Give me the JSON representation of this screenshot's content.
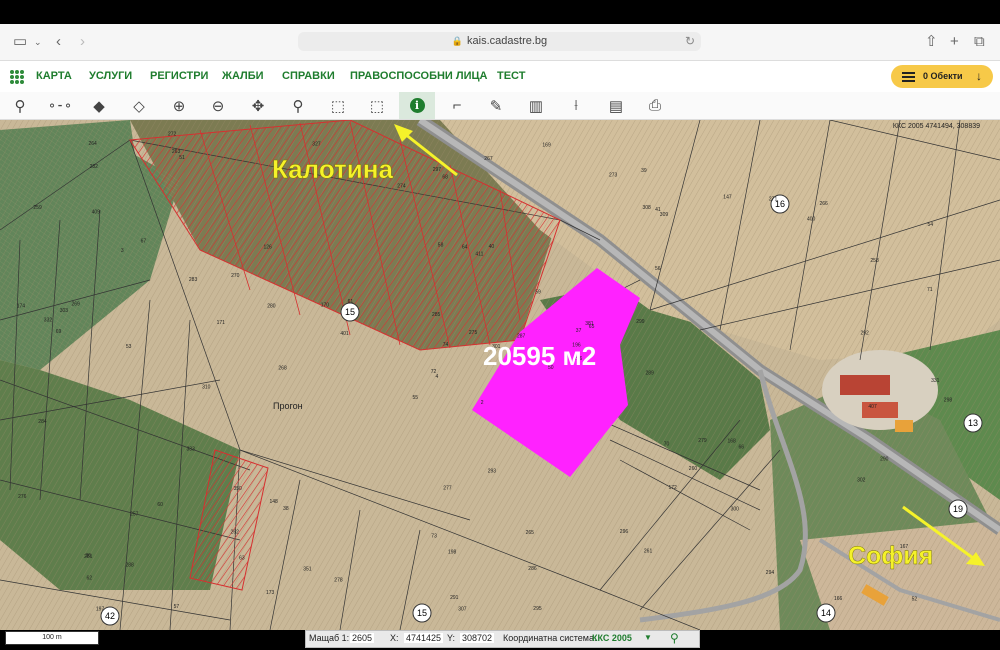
{
  "browser": {
    "url": "kais.cadastre.bg"
  },
  "menu": {
    "items": [
      "КАРТА",
      "УСЛУГИ",
      "РЕГИСТРИ",
      "ЖАЛБИ",
      "СПРАВКИ",
      "ПРАВОСПОСОБНИ ЛИЦА",
      "ТЕСТ"
    ],
    "objects_label": "0 Обекти"
  },
  "toolbar": {
    "tools": [
      "search-icon",
      "graph-icon",
      "layers-icon",
      "layers-stack-icon",
      "zoom-in-icon",
      "zoom-out-icon",
      "pan-icon",
      "location-pin-icon",
      "select-add-icon",
      "select-remove-icon",
      "info-icon",
      "corner-measure-icon",
      "draw-polygon-icon",
      "map-icon",
      "split-icon",
      "edit-document-icon",
      "print-icon"
    ],
    "active_tool": "info-icon"
  },
  "map": {
    "coord_readout": "ККС 2005 4741494, 308839",
    "labels": {
      "kalotina": "Калотина",
      "sofia": "София",
      "area": "20595 м2",
      "progon": "Прогон"
    },
    "road_numbers": [
      "15",
      "16",
      "13",
      "19",
      "14",
      "15",
      "42"
    ],
    "parcel_numbers": [
      "2",
      "3",
      "4",
      "36",
      "37",
      "38",
      "39",
      "40",
      "41",
      "50",
      "51",
      "52",
      "53",
      "54",
      "55",
      "56",
      "57",
      "58",
      "59",
      "60",
      "61",
      "62",
      "63",
      "64",
      "65",
      "66",
      "67",
      "68",
      "69",
      "70",
      "71",
      "72",
      "73",
      "74",
      "126",
      "147",
      "148",
      "166",
      "167",
      "168",
      "169",
      "170",
      "171",
      "172",
      "173",
      "174",
      "196",
      "197",
      "198",
      "256",
      "257",
      "258",
      "259",
      "260",
      "261",
      "262",
      "263",
      "264",
      "265",
      "266",
      "267",
      "268",
      "269",
      "270",
      "271",
      "272",
      "273",
      "274",
      "275",
      "276",
      "277",
      "278",
      "279",
      "280",
      "281",
      "282",
      "283",
      "284",
      "285",
      "286",
      "287",
      "288",
      "289",
      "290",
      "291",
      "292",
      "293",
      "294",
      "295",
      "296",
      "297",
      "298",
      "299",
      "300",
      "301",
      "302",
      "303",
      "307",
      "308",
      "309",
      "310",
      "327",
      "331",
      "332",
      "333",
      "350",
      "351",
      "381",
      "400",
      "401",
      "407",
      "409",
      "411"
    ]
  },
  "colors": {
    "accent": "#1f7d2e",
    "highlight_parcel": "#ff22ff",
    "hatched": "#d63030",
    "annotation": "#f5f22a"
  },
  "status": {
    "scale_bar": "100 m",
    "scale_label": "Мащаб 1:",
    "scale_value": "2605",
    "x_label": "X:",
    "x_value": "4741425",
    "y_label": "Y:",
    "y_value": "308702",
    "system_label": "Координатна система:",
    "system_value": "ККС 2005"
  }
}
